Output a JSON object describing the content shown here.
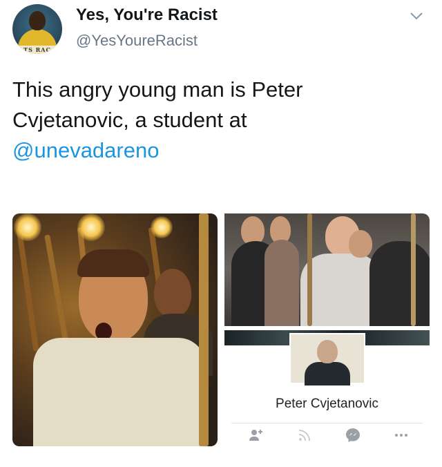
{
  "tweet": {
    "display_name": "Yes, You're Racist",
    "handle": "@YesYoureRacist",
    "text_line1": "This angry young man is Peter",
    "text_line2": "Cvjetanovic, a student at",
    "mention": "@unevadareno"
  },
  "avatar": {
    "band_text": "TS RAC"
  },
  "media": {
    "facebook_card": {
      "name": "Peter Cvjetanovic",
      "actions": [
        "add-friend-icon",
        "follow-icon",
        "messenger-icon",
        "more-icon"
      ]
    }
  },
  "colors": {
    "text": "#14171a",
    "secondary": "#657786",
    "link": "#1b95e0"
  }
}
